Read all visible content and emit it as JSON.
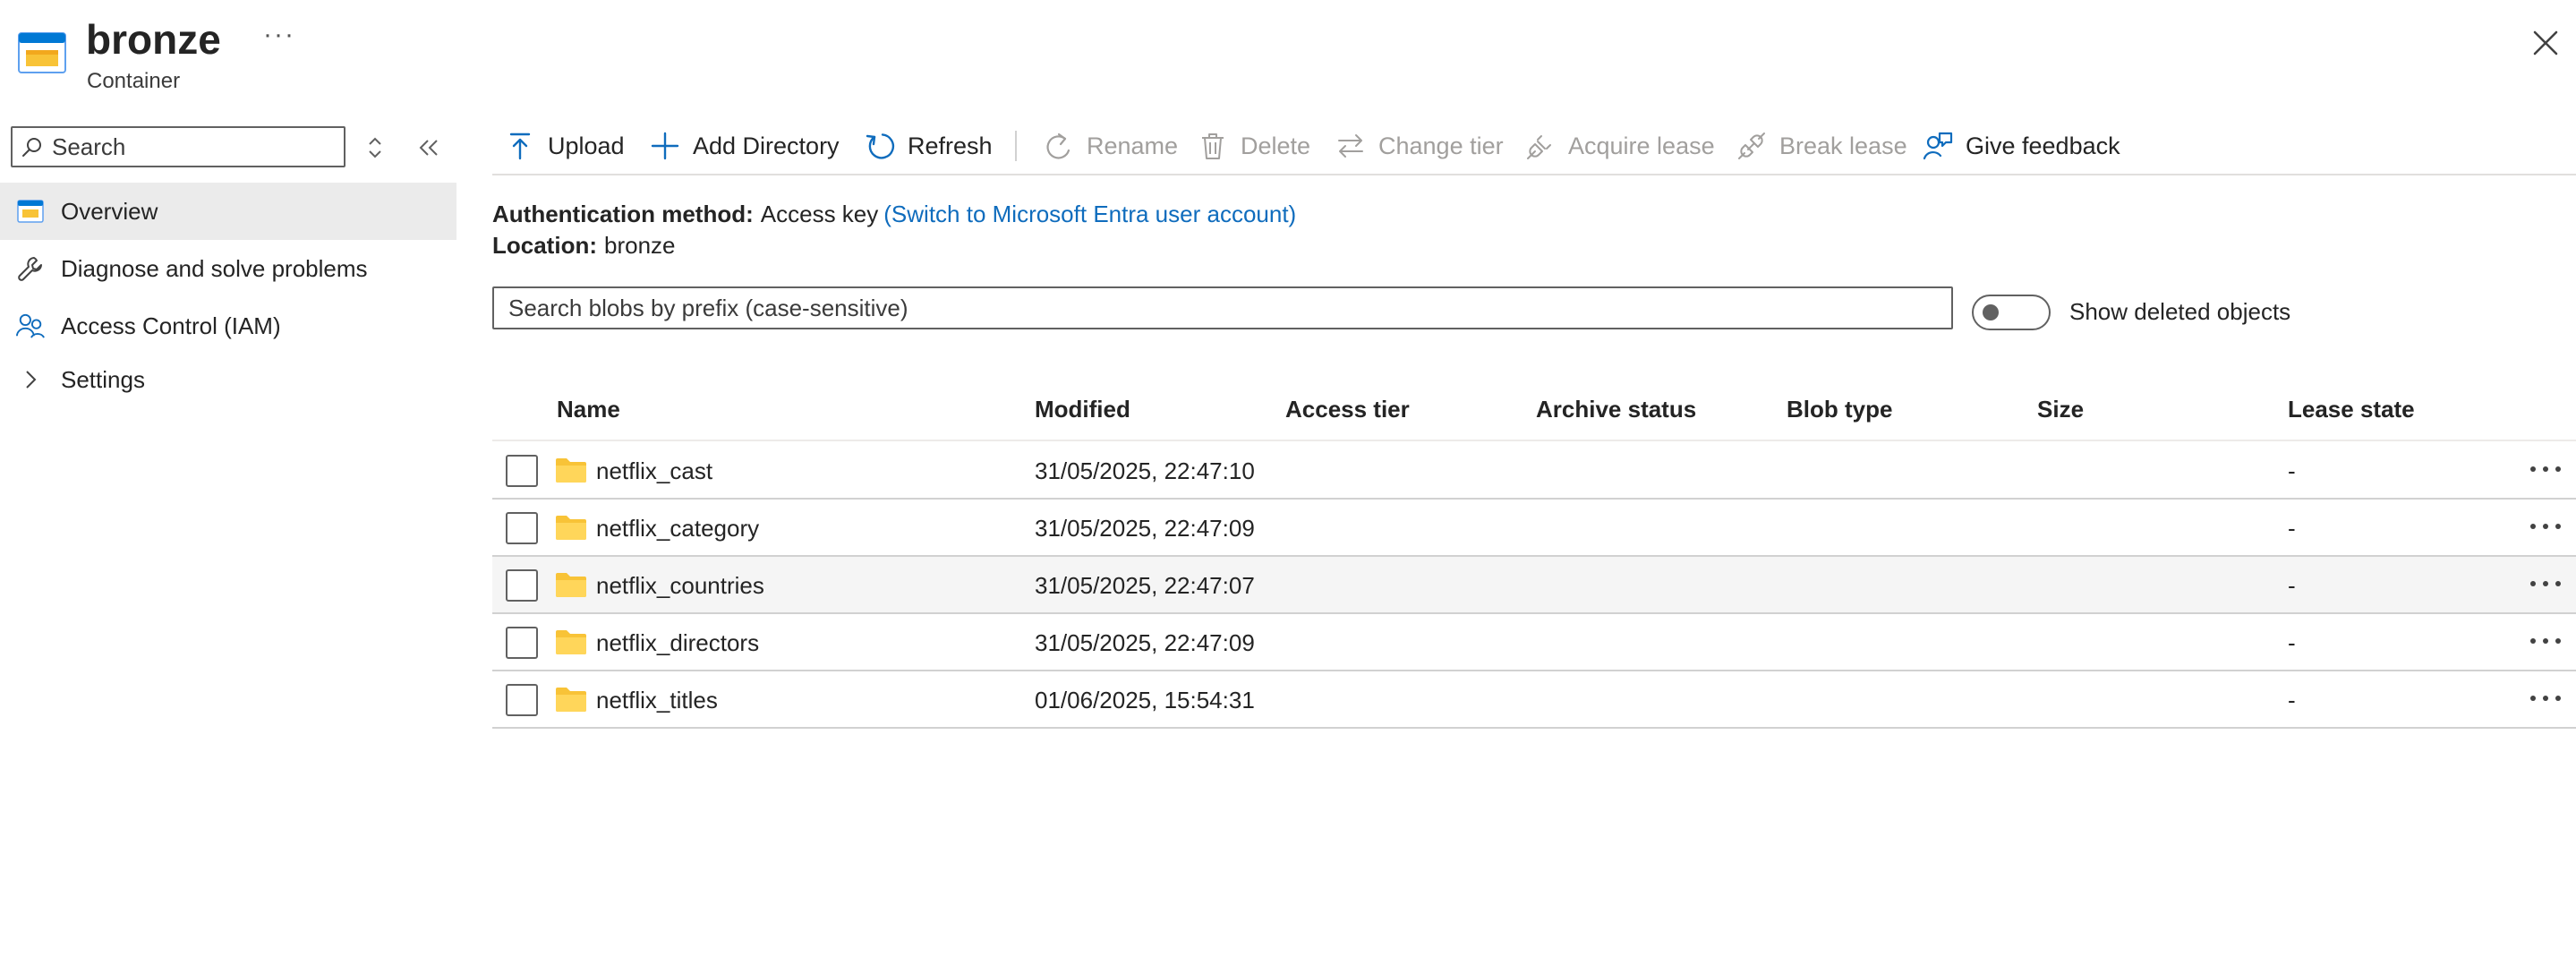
{
  "header": {
    "title": "bronze",
    "subtitle": "Container",
    "more_label": "···"
  },
  "sidebar": {
    "search_placeholder": "Search",
    "items": [
      {
        "label": "Overview",
        "icon": "container-icon",
        "active": true
      },
      {
        "label": "Diagnose and solve problems",
        "icon": "wrench-icon",
        "active": false
      },
      {
        "label": "Access Control (IAM)",
        "icon": "people-icon",
        "active": false
      },
      {
        "label": "Settings",
        "icon": "chevron-right-icon",
        "active": false
      }
    ]
  },
  "toolbar": {
    "upload": "Upload",
    "add_directory": "Add Directory",
    "refresh": "Refresh",
    "rename": "Rename",
    "delete": "Delete",
    "change_tier": "Change tier",
    "acquire_lease": "Acquire lease",
    "break_lease": "Break lease",
    "give_feedback": "Give feedback"
  },
  "info": {
    "auth_label": "Authentication method:",
    "auth_value": "Access key",
    "auth_link": "(Switch to Microsoft Entra user account)",
    "location_label": "Location:",
    "location_value": "bronze"
  },
  "blob_search": {
    "placeholder": "Search blobs by prefix (case-sensitive)"
  },
  "show_deleted": {
    "label": "Show deleted objects",
    "on": false
  },
  "table": {
    "columns": {
      "name": "Name",
      "modified": "Modified",
      "access_tier": "Access tier",
      "archive_status": "Archive status",
      "blob_type": "Blob type",
      "size": "Size",
      "lease_state": "Lease state"
    },
    "rows": [
      {
        "name": "netflix_cast",
        "modified": "31/05/2025, 22:47:10",
        "lease": "-"
      },
      {
        "name": "netflix_category",
        "modified": "31/05/2025, 22:47:09",
        "lease": "-"
      },
      {
        "name": "netflix_countries",
        "modified": "31/05/2025, 22:47:07",
        "lease": "-"
      },
      {
        "name": "netflix_directors",
        "modified": "31/05/2025, 22:47:09",
        "lease": "-"
      },
      {
        "name": "netflix_titles",
        "modified": "01/06/2025, 15:54:31",
        "lease": "-"
      }
    ]
  },
  "colors": {
    "accent": "#0f6cbd",
    "folder": "#f8c337",
    "disabled_text": "#a19f9d",
    "active_nav_bg": "#ebebeb",
    "hover_row_bg": "#f5f5f5"
  }
}
